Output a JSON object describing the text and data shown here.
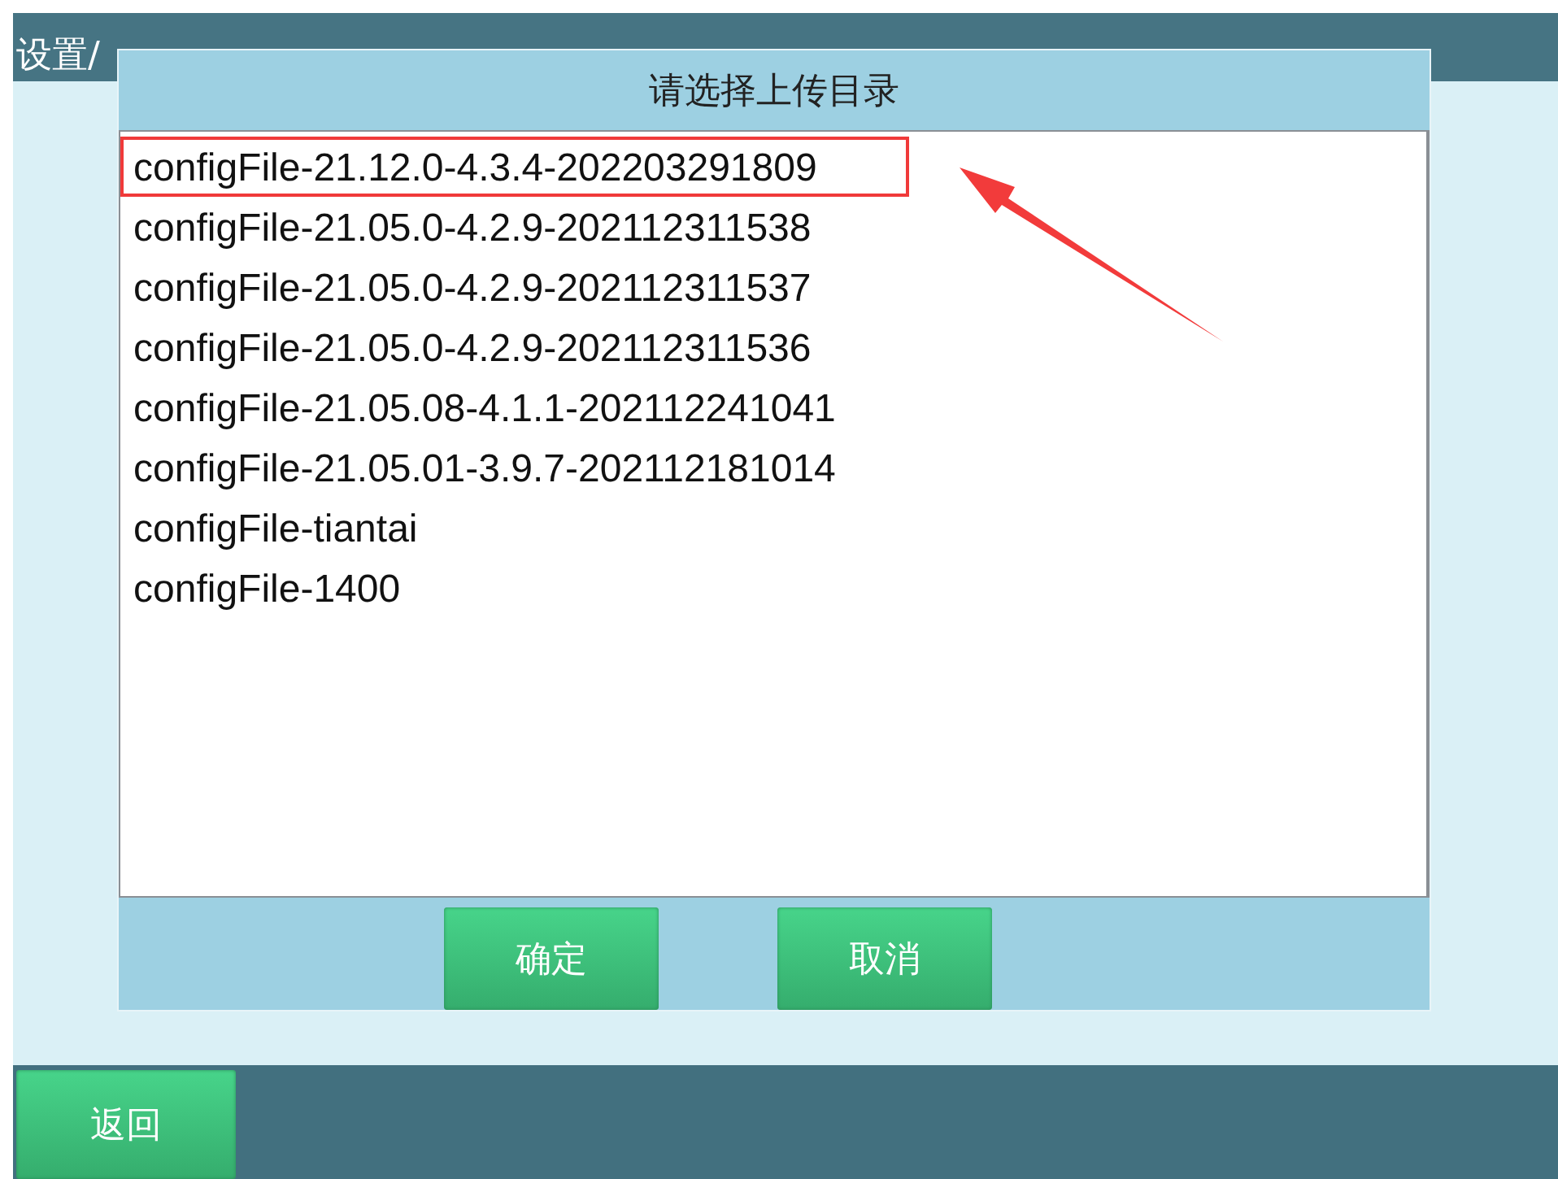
{
  "header": {
    "title": "设置/"
  },
  "dialog": {
    "title": "请选择上传目录",
    "items": [
      {
        "label": "configFile-21.12.0-4.3.4-202203291809",
        "selected": true
      },
      {
        "label": "configFile-21.05.0-4.2.9-202112311538",
        "selected": false
      },
      {
        "label": "configFile-21.05.0-4.2.9-202112311537",
        "selected": false
      },
      {
        "label": "configFile-21.05.0-4.2.9-202112311536",
        "selected": false
      },
      {
        "label": "configFile-21.05.08-4.1.1-202112241041",
        "selected": false
      },
      {
        "label": "configFile-21.05.01-3.9.7-202112181014",
        "selected": false
      },
      {
        "label": "configFile-tiantai",
        "selected": false
      },
      {
        "label": "configFile-1400",
        "selected": false
      }
    ],
    "buttons": [
      "确定",
      "取消"
    ]
  },
  "footer": {
    "back_button": "返回"
  }
}
